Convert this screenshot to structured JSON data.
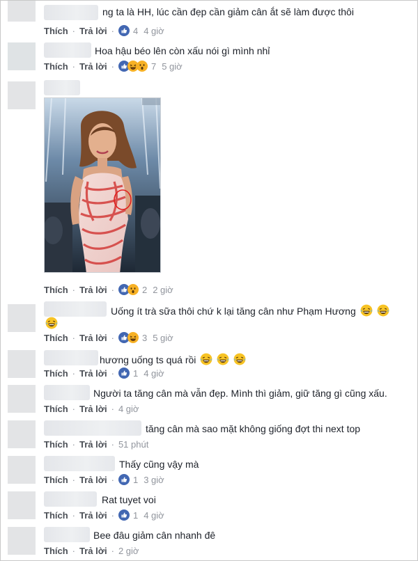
{
  "labels": {
    "like": "Thích",
    "reply": "Trả lời"
  },
  "comments": [
    {
      "text": "ng ta là HH, lúc cần đẹp cần giảm cân ắt sẽ làm được thôi",
      "reactions": "like",
      "count": "4",
      "time": "4 giờ"
    },
    {
      "text": "Hoa hậu béo lên còn xấu nói gì mình nhỉ",
      "reactions": "like,haha,wow",
      "count": "7",
      "time": "5 giờ"
    },
    {
      "text": "",
      "reactions": "like,wow",
      "count": "2",
      "time": "2 giờ"
    },
    {
      "text": "Uống ít trà sữa thôi chứ k lại tăng cân như Phạm Hương",
      "reactions": "like,haha",
      "count": "3",
      "time": "5 giờ"
    },
    {
      "text": "hương uống ts quá rồi",
      "reactions": "like",
      "count": "1",
      "time": "4 giờ"
    },
    {
      "text": "Người ta tăng cân mà vẫn đẹp. Mình thì giảm, giữ tăng gì cũng xấu.",
      "reactions": "",
      "count": "",
      "time": "4 giờ"
    },
    {
      "text": "tăng cân mà sao mặt không giống đợt thi next top",
      "reactions": "",
      "count": "",
      "time": "51 phút"
    },
    {
      "text": "Thấy cũng vậy mà",
      "reactions": "like",
      "count": "1",
      "time": "3 giờ"
    },
    {
      "text": "Rat tuyet voi",
      "reactions": "like",
      "count": "1",
      "time": "4 giờ"
    },
    {
      "text": "Bee đâu giảm cân nhanh đê",
      "reactions": "",
      "count": "",
      "time": "2 giờ"
    }
  ],
  "icons": {
    "like": "like-reaction-icon",
    "haha": "haha-reaction-icon",
    "wow": "wow-reaction-icon",
    "laugh_cry": "laugh-cry-emoji"
  },
  "colors": {
    "like_blue": "#4267b2",
    "reaction_yellow": "#f7b125",
    "link_gray": "#4b4f56",
    "time_gray": "#90949c"
  }
}
